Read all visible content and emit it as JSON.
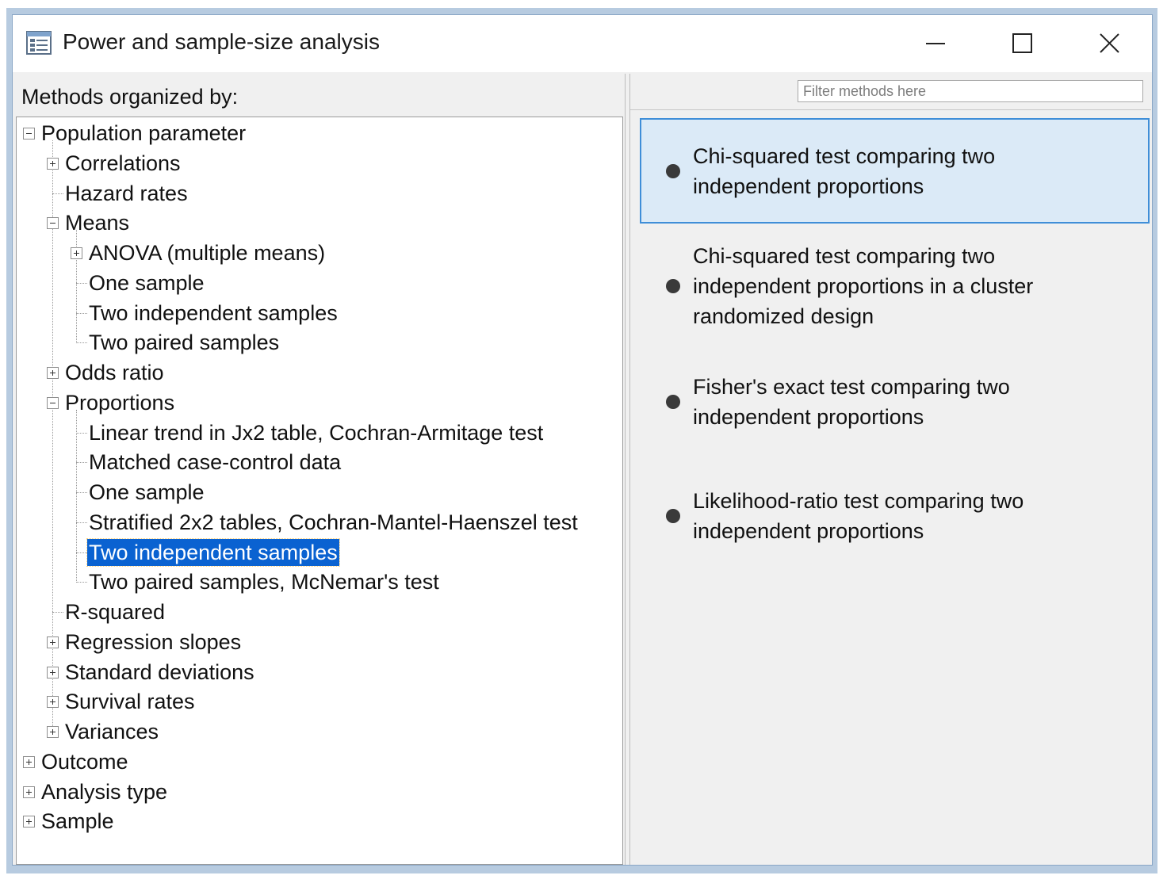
{
  "window": {
    "title": "Power and sample-size analysis",
    "icon": "list-window-icon",
    "controls": [
      "minimize",
      "maximize",
      "close"
    ]
  },
  "left_panel": {
    "heading": "Methods organized by:",
    "tree": [
      {
        "label": "Population parameter",
        "toggle": "minus",
        "level": 0
      },
      {
        "label": "Correlations",
        "toggle": "plus",
        "level": 1
      },
      {
        "label": "Hazard rates",
        "toggle": "none",
        "level": 1
      },
      {
        "label": "Means",
        "toggle": "minus",
        "level": 1
      },
      {
        "label": "ANOVA (multiple means)",
        "toggle": "plus",
        "level": 2
      },
      {
        "label": "One sample",
        "toggle": "none",
        "level": 2
      },
      {
        "label": "Two independent samples",
        "toggle": "none",
        "level": 2
      },
      {
        "label": "Two paired samples",
        "toggle": "none",
        "level": 2
      },
      {
        "label": "Odds ratio",
        "toggle": "plus",
        "level": 1
      },
      {
        "label": "Proportions",
        "toggle": "minus",
        "level": 1
      },
      {
        "label": "Linear trend in Jx2 table, Cochran-Armitage test",
        "toggle": "none",
        "level": 2
      },
      {
        "label": "Matched case-control data",
        "toggle": "none",
        "level": 2
      },
      {
        "label": "One sample",
        "toggle": "none",
        "level": 2
      },
      {
        "label": "Stratified 2x2 tables, Cochran-Mantel-Haenszel test",
        "toggle": "none",
        "level": 2
      },
      {
        "label": "Two independent samples",
        "toggle": "none",
        "level": 2,
        "selected": true
      },
      {
        "label": "Two paired samples, McNemar's test",
        "toggle": "none",
        "level": 2
      },
      {
        "label": "R-squared",
        "toggle": "none",
        "level": 1
      },
      {
        "label": "Regression slopes",
        "toggle": "plus",
        "level": 1
      },
      {
        "label": "Standard deviations",
        "toggle": "plus",
        "level": 1
      },
      {
        "label": "Survival rates",
        "toggle": "plus",
        "level": 1
      },
      {
        "label": "Variances",
        "toggle": "plus",
        "level": 1
      },
      {
        "label": "Outcome",
        "toggle": "plus",
        "level": 0
      },
      {
        "label": "Analysis type",
        "toggle": "plus",
        "level": 0
      },
      {
        "label": "Sample",
        "toggle": "plus",
        "level": 0
      }
    ]
  },
  "right_panel": {
    "filter_placeholder": "Filter methods here",
    "methods": [
      {
        "lines": [
          "Chi-squared test comparing two",
          "independent proportions"
        ],
        "selected": true
      },
      {
        "lines": [
          "Chi-squared test comparing two",
          "independent proportions in a cluster",
          "randomized design"
        ],
        "selected": false
      },
      {
        "lines": [
          "Fisher's exact test comparing two",
          "independent proportions"
        ],
        "selected": false
      },
      {
        "lines": [
          "Likelihood-ratio test comparing two",
          "independent proportions"
        ],
        "selected": false
      }
    ]
  },
  "colors": {
    "selection_blue": "#0a62d1",
    "selected_card_bg": "#dbeaf7",
    "selected_card_border": "#3f8ed8",
    "panel_bg": "#f0f0f0"
  }
}
